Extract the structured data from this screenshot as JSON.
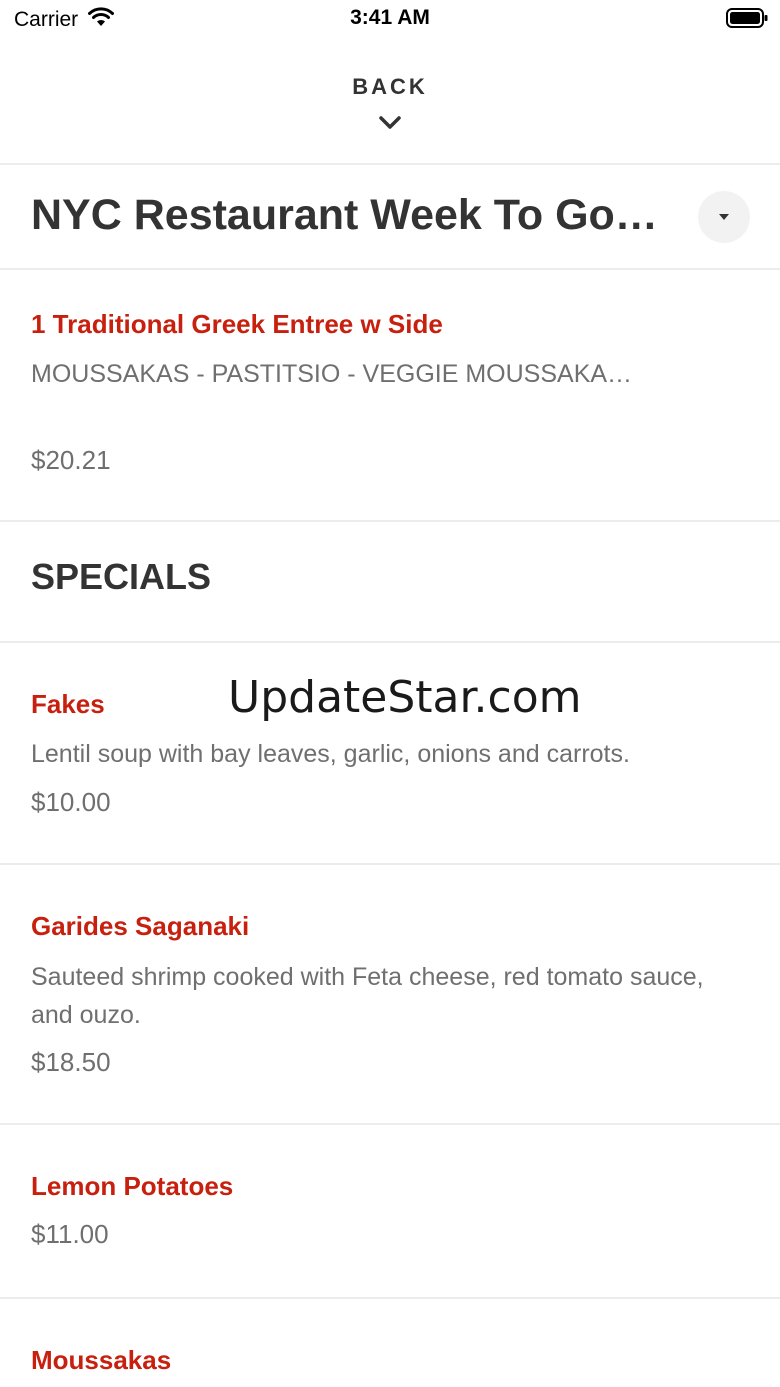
{
  "status_bar": {
    "carrier": "Carrier",
    "time": "3:41 AM"
  },
  "header": {
    "back_label": "BACK"
  },
  "menu_selector": {
    "title": "NYC Restaurant Week To Go(…"
  },
  "featured_item": {
    "name": "1 Traditional Greek Entree w Side",
    "description": "MOUSSAKAS - PASTITSIO - VEGGIE MOUSSAKA…",
    "price": "$20.21"
  },
  "section": {
    "title": "SPECIALS"
  },
  "items": [
    {
      "name": "Fakes",
      "description": "Lentil soup with bay leaves, garlic, onions and carrots.",
      "price": "$10.00"
    },
    {
      "name": "Garides Saganaki",
      "description": "Sauteed shrimp cooked with Feta cheese, red tomato sauce, and ouzo.",
      "price": "$18.50"
    },
    {
      "name": "Lemon Potatoes",
      "description": "",
      "price": "$11.00"
    },
    {
      "name": "Moussakas",
      "description": "",
      "price": ""
    }
  ],
  "watermark": "UpdateStar.com",
  "colors": {
    "accent": "#c8200e",
    "divider": "#ececec",
    "text_primary": "#333333",
    "text_secondary": "#6f6f6f"
  }
}
